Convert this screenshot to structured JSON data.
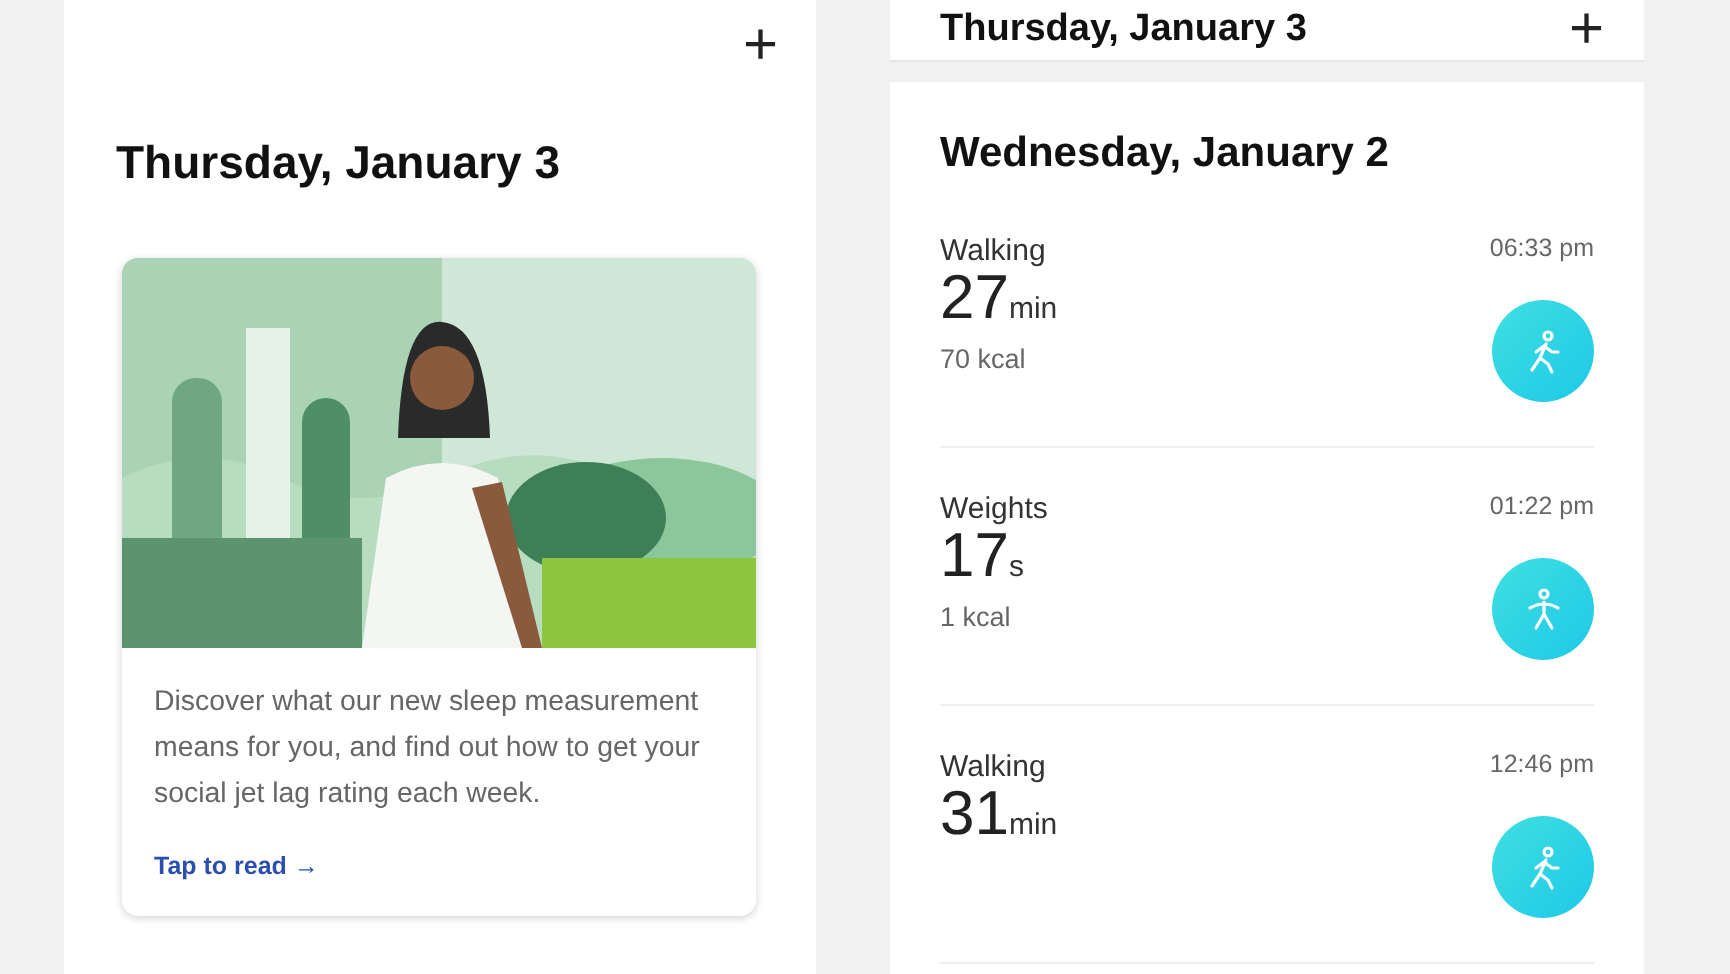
{
  "left_screen": {
    "add_button": "+",
    "date_heading": "Thursday, January 3",
    "article_card": {
      "text": "Discover what our new sleep measurement means for you, and find out how to get your social jet lag rating each week.",
      "link": "Tap to read →"
    }
  },
  "right_screen": {
    "header_title": "Thursday, January 3",
    "add_button": "+",
    "day_heading": "Wednesday, January 2",
    "activities": [
      {
        "kind": "walking",
        "name": "Walking",
        "value": "27",
        "unit": "min",
        "kcal": "70 kcal",
        "time": "06:33 pm"
      },
      {
        "kind": "weights",
        "name": "Weights",
        "value": "17",
        "unit": "s",
        "kcal": "1 kcal",
        "time": "01:22 pm"
      },
      {
        "kind": "walking",
        "name": "Walking",
        "value": "31",
        "unit": "min",
        "time": "12:46 pm"
      }
    ]
  }
}
